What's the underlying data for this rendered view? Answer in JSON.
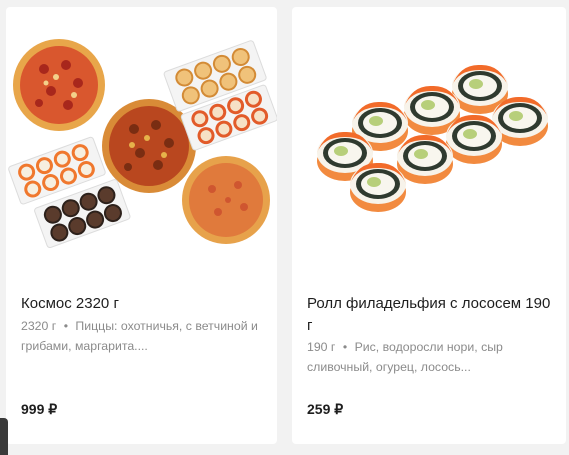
{
  "products": [
    {
      "image_alt": "pizza-and-sushi-set",
      "title": "Космос 2320 г",
      "weight": "2320 г",
      "separator": "•",
      "description": "Пиццы: охотничья, с ветчиной и грибами, маргарита....",
      "price": "999 ₽"
    },
    {
      "image_alt": "philadelphia-roll",
      "title": "Ролл филадельфия с лососем 190 г",
      "weight": "190 г",
      "separator": "•",
      "description": "Рис, водоросли нори, сыр сливочный, огурец, лосось...",
      "price": "259 ₽"
    }
  ],
  "colors": {
    "background": "#f2f2f2",
    "card": "#ffffff",
    "text": "#1e1e1e",
    "muted": "#8b8b8b",
    "salmon": "#f26b2a"
  }
}
